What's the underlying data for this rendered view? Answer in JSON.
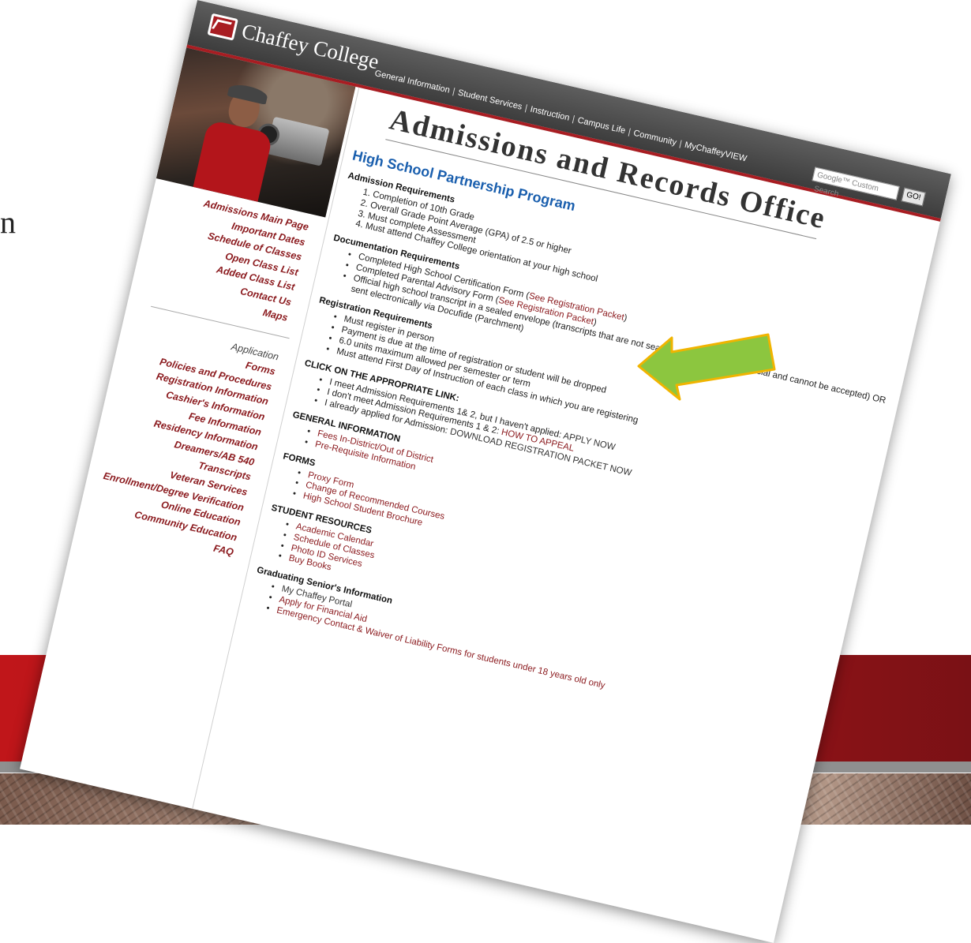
{
  "slide": {
    "left_char": "n"
  },
  "site": {
    "logo_text": "Chaffey College",
    "nav": [
      "General Information",
      "Student Services",
      "Instruction",
      "Campus Life",
      "Community",
      "MyChaffeyVIEW"
    ],
    "search_placeholder": "Google™ Custom Search",
    "search_button": "GO!"
  },
  "sidebar": {
    "primary": [
      "Admissions Main Page",
      "Important Dates",
      "Schedule of Classes",
      "Open Class List",
      "Added Class List",
      "Contact Us",
      "Maps"
    ],
    "heading": "Application",
    "secondary": [
      "Forms",
      "Policies and Procedures",
      "Registration Information",
      "Cashier's Information",
      "Fee Information",
      "Residency Information",
      "Dreamers/AB 540",
      "Transcripts",
      "Veteran Services",
      "Enrollment/Degree Verification",
      "Online Education",
      "Community Education",
      "FAQ"
    ]
  },
  "main": {
    "title": "Admissions and Records Office",
    "subtitle": "High School Partnership Program",
    "admission_heading": "Admission Requirements",
    "admission_items": [
      "Completion of 10th Grade",
      "Overall Grade Point Average (GPA) of 2.5 or higher",
      "Must complete Assessment",
      "Must attend Chaffey College orientation at your high school"
    ],
    "documentation_heading": "Documentation Requirements",
    "doc_item1_text": "Completed High School Certification Form (",
    "doc_item1_link": "See Registration Packet",
    "doc_item1_end": ")",
    "doc_item2_text": "Completed Parental Advisory Form (",
    "doc_item2_link": "See Registration Packet",
    "doc_item2_end": ")",
    "doc_item3": "Official high school transcript in a sealed envelope (transcripts that are not sealed are considered unofficial and cannot be accepted) OR sent electronically via Docufide (Parchment)",
    "registration_heading": "Registration Requirements",
    "registration_items": [
      "Must register in person",
      "Payment is due at the time of registration or student will be dropped",
      "6.0 units maximum allowed per semester or term",
      "Must attend First Day of Instruction of each class in which you are registering"
    ],
    "click_heading": "CLICK ON THE APPROPRIATE LINK:",
    "click_item1_text": "I meet Admission Requirements 1& 2, but I haven't applied: ",
    "click_item1_link": "APPLY NOW",
    "click_item2_text": "I don't meet Admission Requirements 1 & 2: ",
    "click_item2_link": "HOW TO APPEAL",
    "click_item3_text": "I already applied for Admission: ",
    "click_item3_link": "DOWNLOAD REGISTRATION PACKET NOW",
    "general_heading": "GENERAL INFORMATION",
    "general_items": [
      "Fees In-District/Out of District",
      "Pre-Requisite Information"
    ],
    "forms_heading": "FORMS",
    "forms_items": [
      "Proxy Form",
      "Change of Recommended Courses",
      "High School Student Brochure"
    ],
    "resources_heading": "STUDENT RESOURCES",
    "resources_items": [
      "Academic Calendar",
      "Schedule of Classes",
      "Photo ID Services",
      "Buy Books"
    ],
    "seniors_heading": "Graduating Senior's Information",
    "seniors_items": [
      "My Chaffey Portal",
      "Apply for Financial Aid",
      "Emergency Contact & Waiver of Liability Forms for students under 18 years old only"
    ]
  },
  "annotation": {
    "arrow_color": "#8cc63f",
    "arrow_border": "#f0b400"
  },
  "colors": {
    "brand_red": "#a81d22",
    "link_red": "#8b1a1e",
    "subtitle_blue": "#1a5fae"
  }
}
